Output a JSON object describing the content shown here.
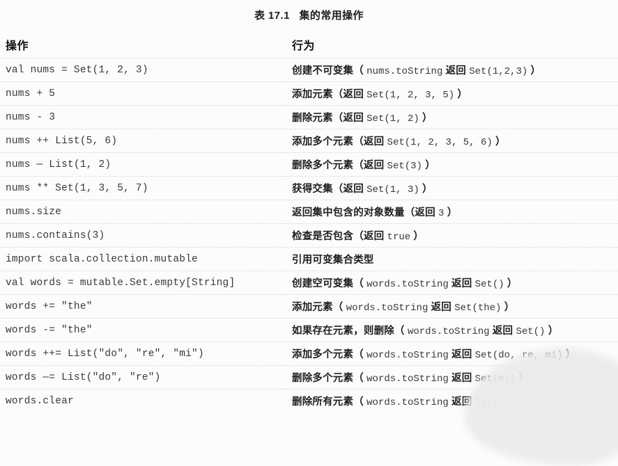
{
  "page": {
    "caption": "表 17.1   集的常用操作",
    "background_color": "#fdfcfb",
    "text_color": "#2f2f2f"
  },
  "table": {
    "headers": {
      "operation": "操作",
      "behavior": "行为"
    },
    "rows": [
      {
        "operation": "val nums = Set(1, 2, 3)",
        "behavior_prefix": "创建不可变集（",
        "behavior_code_1": "nums.toString",
        "behavior_mid": "返回",
        "behavior_code_2": "Set(1,2,3)",
        "behavior_suffix": "）",
        "behavior_plain": "创建不可变集（nums.toString 返回 Set(1,2,3)）"
      },
      {
        "operation": "nums + 5",
        "behavior_prefix": "添加元素（返回",
        "behavior_code_1": "Set(1, 2, 3, 5)",
        "behavior_mid": "",
        "behavior_code_2": "",
        "behavior_suffix": "）",
        "behavior_plain": "添加元素（返回 Set(1, 2, 3, 5)）"
      },
      {
        "operation": "nums - 3",
        "behavior_prefix": "删除元素（返回",
        "behavior_code_1": "Set(1, 2)",
        "behavior_mid": "",
        "behavior_code_2": "",
        "behavior_suffix": "）",
        "behavior_plain": "删除元素（返回 Set(1, 2)）"
      },
      {
        "operation": "nums ++ List(5, 6)",
        "behavior_prefix": "添加多个元素（返回",
        "behavior_code_1": "Set(1, 2, 3, 5, 6)",
        "behavior_mid": "",
        "behavior_code_2": "",
        "behavior_suffix": "）",
        "behavior_plain": "添加多个元素（返回 Set(1, 2, 3, 5, 6)）"
      },
      {
        "operation": "nums — List(1, 2)",
        "behavior_prefix": "删除多个元素（返回",
        "behavior_code_1": "Set(3)",
        "behavior_mid": "",
        "behavior_code_2": "",
        "behavior_suffix": "）",
        "behavior_plain": "删除多个元素（返回 Set(3)）"
      },
      {
        "operation": "nums ** Set(1, 3, 5, 7)",
        "behavior_prefix": "获得交集（返回",
        "behavior_code_1": "Set(1, 3)",
        "behavior_mid": "",
        "behavior_code_2": "",
        "behavior_suffix": "）",
        "behavior_plain": "获得交集（返回 Set(1, 3)）"
      },
      {
        "operation": "nums.size",
        "behavior_prefix": "返回集中包含的对象数量（返回",
        "behavior_code_1": "3",
        "behavior_mid": "",
        "behavior_code_2": "",
        "behavior_suffix": "）",
        "behavior_plain": "返回集中包含的对象数量（返回 3）"
      },
      {
        "operation": "nums.contains(3)",
        "behavior_prefix": "检查是否包含（返回",
        "behavior_code_1": "true",
        "behavior_mid": "",
        "behavior_code_2": "",
        "behavior_suffix": "）",
        "behavior_plain": "检查是否包含（返回 true）"
      },
      {
        "operation": "import scala.collection.mutable",
        "behavior_prefix": "引用可变集合类型",
        "behavior_code_1": "",
        "behavior_mid": "",
        "behavior_code_2": "",
        "behavior_suffix": "",
        "behavior_plain": "引用可变集合类型"
      },
      {
        "operation": "val words = mutable.Set.empty[String]",
        "behavior_prefix": "创建空可变集（",
        "behavior_code_1": "words.toString",
        "behavior_mid": "返回",
        "behavior_code_2": "Set()",
        "behavior_suffix": "）",
        "behavior_plain": "创建空可变集（words.toString 返回 Set()）"
      },
      {
        "operation": "words += \"the\"",
        "behavior_prefix": "添加元素（",
        "behavior_code_1": "words.toString",
        "behavior_mid": "返回",
        "behavior_code_2": "Set(the)",
        "behavior_suffix": "）",
        "behavior_plain": "添加元素（words.toString 返回 Set(the)）"
      },
      {
        "operation": "words -= \"the\"",
        "behavior_prefix": "如果存在元素，则删除（",
        "behavior_code_1": "words.toString",
        "behavior_mid": "返回",
        "behavior_code_2": "Set()",
        "behavior_suffix": "）",
        "behavior_plain": "如果存在元素，则删除（words.toString 返回 Set()）"
      },
      {
        "operation": "words ++= List(\"do\", \"re\", \"mi\")",
        "behavior_prefix": "添加多个元素（",
        "behavior_code_1": "words.toString",
        "behavior_mid": "返回",
        "behavior_code_2": "Set(do, re, mi)",
        "behavior_suffix": "）",
        "behavior_plain": "添加多个元素（words.toString 返回 Set(do, re, mi)）"
      },
      {
        "operation": "words —= List(\"do\", \"re\")",
        "behavior_prefix": "删除多个元素（",
        "behavior_code_1": "words.toString",
        "behavior_mid": "返回",
        "behavior_code_2": "Set(mi)",
        "behavior_suffix": "）",
        "behavior_plain": "删除多个元素（words.toString 返回 Set(mi)）"
      },
      {
        "operation": "words.clear",
        "behavior_prefix": "删除所有元素（",
        "behavior_code_1": "words.toString",
        "behavior_mid": "返回",
        "behavior_code_2": "Set()",
        "behavior_suffix": "）",
        "behavior_plain": "删除所有元素（words.toString 返回 Set()）"
      }
    ]
  }
}
